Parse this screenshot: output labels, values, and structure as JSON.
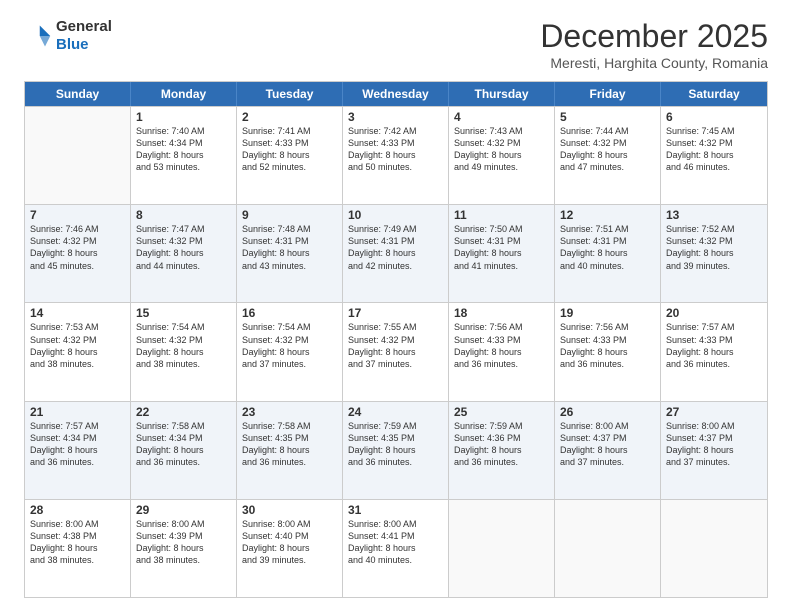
{
  "header": {
    "logo_general": "General",
    "logo_blue": "Blue",
    "title": "December 2025",
    "location": "Meresti, Harghita County, Romania"
  },
  "days_of_week": [
    "Sunday",
    "Monday",
    "Tuesday",
    "Wednesday",
    "Thursday",
    "Friday",
    "Saturday"
  ],
  "rows": [
    [
      {
        "day": "",
        "info": "",
        "empty": true
      },
      {
        "day": "1",
        "info": "Sunrise: 7:40 AM\nSunset: 4:34 PM\nDaylight: 8 hours\nand 53 minutes."
      },
      {
        "day": "2",
        "info": "Sunrise: 7:41 AM\nSunset: 4:33 PM\nDaylight: 8 hours\nand 52 minutes."
      },
      {
        "day": "3",
        "info": "Sunrise: 7:42 AM\nSunset: 4:33 PM\nDaylight: 8 hours\nand 50 minutes."
      },
      {
        "day": "4",
        "info": "Sunrise: 7:43 AM\nSunset: 4:32 PM\nDaylight: 8 hours\nand 49 minutes."
      },
      {
        "day": "5",
        "info": "Sunrise: 7:44 AM\nSunset: 4:32 PM\nDaylight: 8 hours\nand 47 minutes."
      },
      {
        "day": "6",
        "info": "Sunrise: 7:45 AM\nSunset: 4:32 PM\nDaylight: 8 hours\nand 46 minutes."
      }
    ],
    [
      {
        "day": "7",
        "info": "Sunrise: 7:46 AM\nSunset: 4:32 PM\nDaylight: 8 hours\nand 45 minutes."
      },
      {
        "day": "8",
        "info": "Sunrise: 7:47 AM\nSunset: 4:32 PM\nDaylight: 8 hours\nand 44 minutes."
      },
      {
        "day": "9",
        "info": "Sunrise: 7:48 AM\nSunset: 4:31 PM\nDaylight: 8 hours\nand 43 minutes."
      },
      {
        "day": "10",
        "info": "Sunrise: 7:49 AM\nSunset: 4:31 PM\nDaylight: 8 hours\nand 42 minutes."
      },
      {
        "day": "11",
        "info": "Sunrise: 7:50 AM\nSunset: 4:31 PM\nDaylight: 8 hours\nand 41 minutes."
      },
      {
        "day": "12",
        "info": "Sunrise: 7:51 AM\nSunset: 4:31 PM\nDaylight: 8 hours\nand 40 minutes."
      },
      {
        "day": "13",
        "info": "Sunrise: 7:52 AM\nSunset: 4:32 PM\nDaylight: 8 hours\nand 39 minutes."
      }
    ],
    [
      {
        "day": "14",
        "info": "Sunrise: 7:53 AM\nSunset: 4:32 PM\nDaylight: 8 hours\nand 38 minutes."
      },
      {
        "day": "15",
        "info": "Sunrise: 7:54 AM\nSunset: 4:32 PM\nDaylight: 8 hours\nand 38 minutes."
      },
      {
        "day": "16",
        "info": "Sunrise: 7:54 AM\nSunset: 4:32 PM\nDaylight: 8 hours\nand 37 minutes."
      },
      {
        "day": "17",
        "info": "Sunrise: 7:55 AM\nSunset: 4:32 PM\nDaylight: 8 hours\nand 37 minutes."
      },
      {
        "day": "18",
        "info": "Sunrise: 7:56 AM\nSunset: 4:33 PM\nDaylight: 8 hours\nand 36 minutes."
      },
      {
        "day": "19",
        "info": "Sunrise: 7:56 AM\nSunset: 4:33 PM\nDaylight: 8 hours\nand 36 minutes."
      },
      {
        "day": "20",
        "info": "Sunrise: 7:57 AM\nSunset: 4:33 PM\nDaylight: 8 hours\nand 36 minutes."
      }
    ],
    [
      {
        "day": "21",
        "info": "Sunrise: 7:57 AM\nSunset: 4:34 PM\nDaylight: 8 hours\nand 36 minutes."
      },
      {
        "day": "22",
        "info": "Sunrise: 7:58 AM\nSunset: 4:34 PM\nDaylight: 8 hours\nand 36 minutes."
      },
      {
        "day": "23",
        "info": "Sunrise: 7:58 AM\nSunset: 4:35 PM\nDaylight: 8 hours\nand 36 minutes."
      },
      {
        "day": "24",
        "info": "Sunrise: 7:59 AM\nSunset: 4:35 PM\nDaylight: 8 hours\nand 36 minutes."
      },
      {
        "day": "25",
        "info": "Sunrise: 7:59 AM\nSunset: 4:36 PM\nDaylight: 8 hours\nand 36 minutes."
      },
      {
        "day": "26",
        "info": "Sunrise: 8:00 AM\nSunset: 4:37 PM\nDaylight: 8 hours\nand 37 minutes."
      },
      {
        "day": "27",
        "info": "Sunrise: 8:00 AM\nSunset: 4:37 PM\nDaylight: 8 hours\nand 37 minutes."
      }
    ],
    [
      {
        "day": "28",
        "info": "Sunrise: 8:00 AM\nSunset: 4:38 PM\nDaylight: 8 hours\nand 38 minutes."
      },
      {
        "day": "29",
        "info": "Sunrise: 8:00 AM\nSunset: 4:39 PM\nDaylight: 8 hours\nand 38 minutes."
      },
      {
        "day": "30",
        "info": "Sunrise: 8:00 AM\nSunset: 4:40 PM\nDaylight: 8 hours\nand 39 minutes."
      },
      {
        "day": "31",
        "info": "Sunrise: 8:00 AM\nSunset: 4:41 PM\nDaylight: 8 hours\nand 40 minutes."
      },
      {
        "day": "",
        "info": "",
        "empty": true
      },
      {
        "day": "",
        "info": "",
        "empty": true
      },
      {
        "day": "",
        "info": "",
        "empty": true
      }
    ]
  ]
}
